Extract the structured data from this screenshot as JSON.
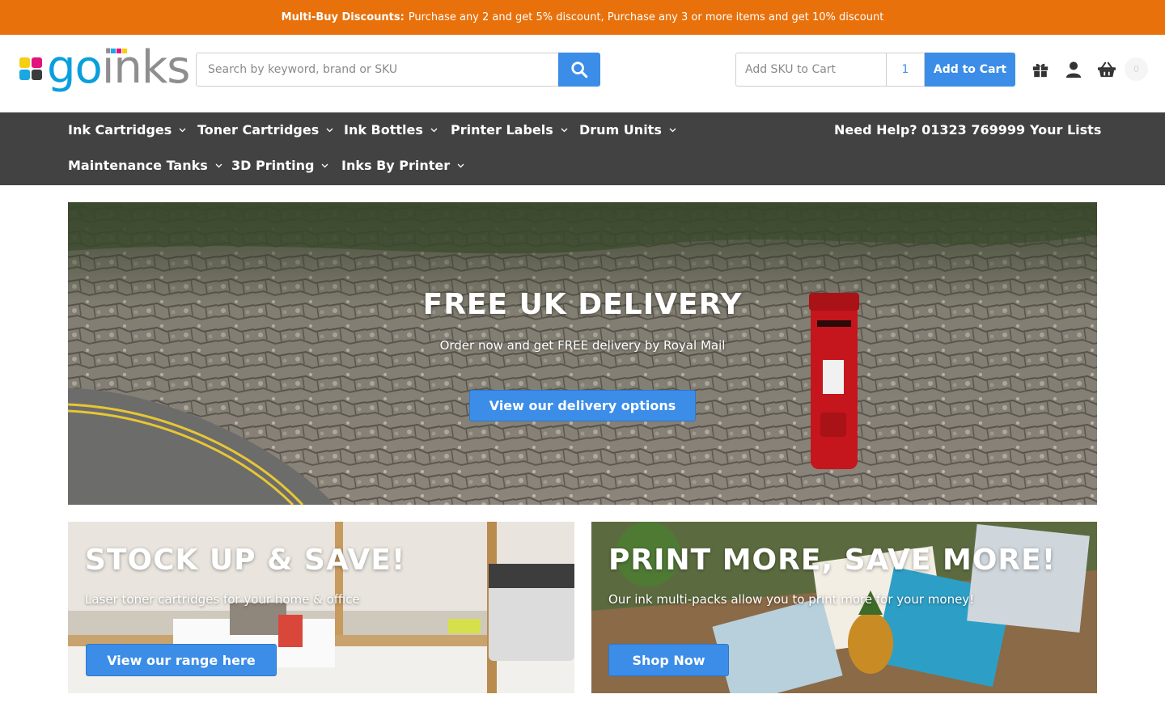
{
  "announcement": {
    "label": "Multi-Buy Discounts:",
    "text": "Purchase any 2 and get 5% discount, Purchase any 3 or more items and get 10% discount"
  },
  "header": {
    "logo": {
      "text_go": "go",
      "text_inks": "inks"
    },
    "search": {
      "placeholder": "Search by keyword, brand or SKU"
    },
    "quick_add": {
      "sku_placeholder": "Add SKU to Cart",
      "quantity": "1",
      "button_label": "Add to Cart"
    },
    "icons": [
      "gift-icon",
      "account-icon",
      "basket-icon"
    ],
    "cart_count": "0"
  },
  "nav": {
    "row1": [
      {
        "label": "Ink Cartridges"
      },
      {
        "label": "Toner Cartridges"
      },
      {
        "label": "Ink Bottles"
      },
      {
        "label": "Printer Labels"
      },
      {
        "label": "Drum Units"
      }
    ],
    "row2": [
      {
        "label": "Maintenance Tanks"
      },
      {
        "label": "3D Printing"
      },
      {
        "label": "Inks By Printer"
      }
    ],
    "help": "Need Help? 01323 769999",
    "lists": "Your Lists"
  },
  "hero": {
    "title": "FREE UK DELIVERY",
    "subtitle": "Order now and get FREE delivery by Royal Mail",
    "button": "View our delivery options"
  },
  "tiles": [
    {
      "title": "STOCK UP & SAVE!",
      "subtitle": "Laser toner cartridges for your home & office",
      "button": "View our range here"
    },
    {
      "title": "PRINT MORE, SAVE MORE!",
      "subtitle": "Our ink multi-packs allow you to print more for your money!",
      "button": "Shop Now"
    }
  ],
  "colors": {
    "announcement_bg": "#e8710b",
    "accent_blue": "#3b8de8",
    "nav_bg": "#424242",
    "logo_blue": "#0a9fdc"
  }
}
